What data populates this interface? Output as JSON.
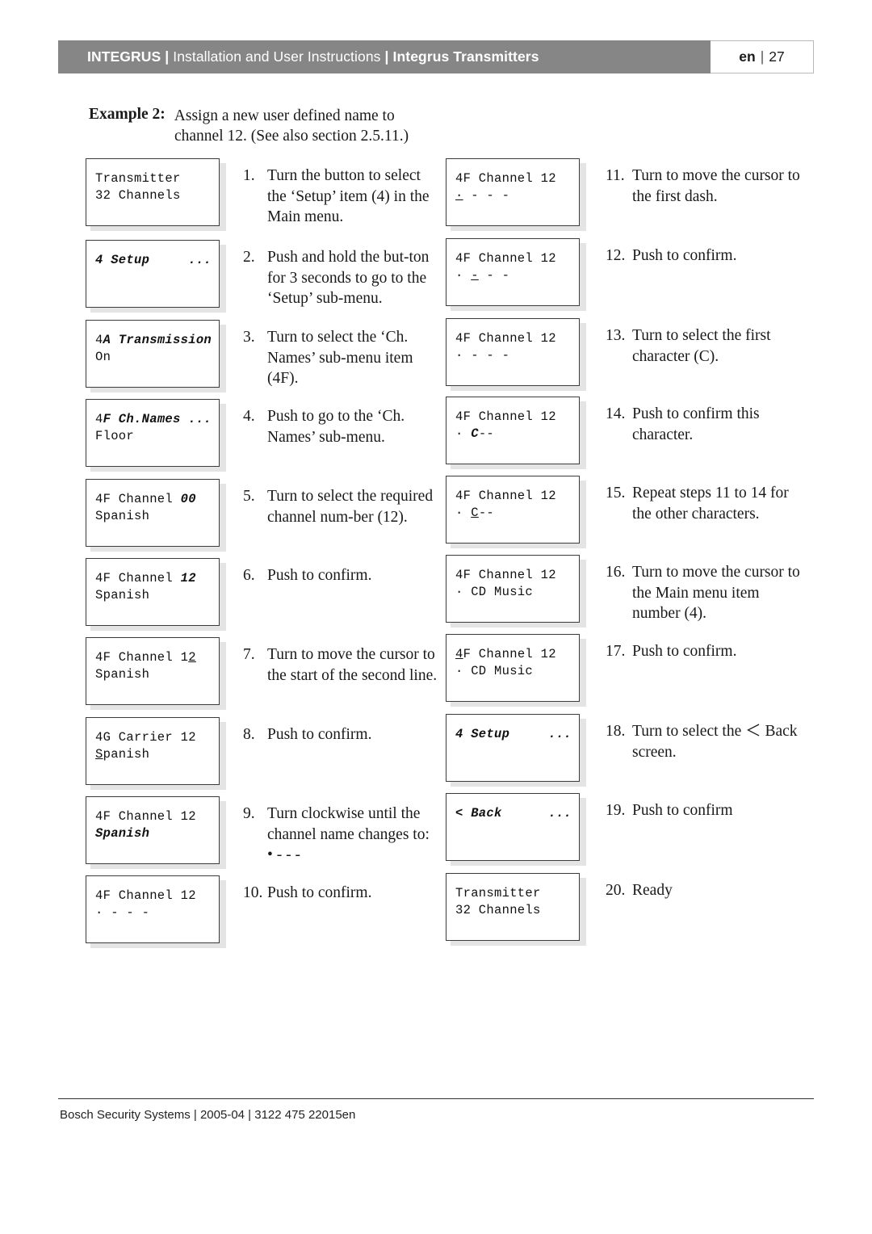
{
  "header": {
    "brand": "INTEGRUS",
    "sep": "|",
    "subtitle": "Installation and User Instructions",
    "section": "Integrus Transmitters",
    "language": "en",
    "page_number": "27"
  },
  "example": {
    "label": "Example 2:",
    "line1": "Assign a new user defined name to",
    "line2": "channel 12. (See also section 2.5.11.)"
  },
  "steps": [
    {
      "number": "1.",
      "text": "Turn the button to select the ‘Setup’ item (4) in the Main menu.",
      "lcd_line1": "Transmitter",
      "lcd_line2": "32 Channels"
    },
    {
      "number": "2.",
      "text": "Push and hold the but-ton for 3 seconds to go to the ‘Setup’ sub-menu.",
      "lcd_line1": "4 Setup     ...",
      "lcd_line2": ""
    },
    {
      "number": "3.",
      "text": "Turn to select the ‘Ch. Names’ sub-menu item (4F).",
      "lcd_line1": "4A Transmission",
      "lcd_line2": "On"
    },
    {
      "number": "4.",
      "text": "Push to go to the ‘Ch. Names’ sub-menu.",
      "lcd_line1": "4F Ch.Names ...",
      "lcd_line2": "Floor"
    },
    {
      "number": "5.",
      "text": "Turn to select the required channel num-ber (12).",
      "lcd_line1": "4F Channel 00",
      "lcd_line2": "Spanish"
    },
    {
      "number": "6.",
      "text": "Push to confirm.",
      "lcd_line1": "4F Channel 12",
      "lcd_line2": "Spanish"
    },
    {
      "number": "7.",
      "text": "Turn to move the cursor to the start of the second line.",
      "lcd_line1": "4F Channel 12",
      "lcd_line2": "Spanish"
    },
    {
      "number": "8.",
      "text": "Push to confirm.",
      "lcd_line1": "4G Carrier 12",
      "lcd_line2": "Spanish"
    },
    {
      "number": "9.",
      "text": "Turn clockwise until the channel name changes to: • - - -",
      "lcd_line1": "4F Channel 12",
      "lcd_line2": "Spanish"
    },
    {
      "number": "10.",
      "text": "Push to confirm.",
      "lcd_line1": "4F Channel 12",
      "lcd_line2": "· - - -"
    },
    {
      "number": "11.",
      "text": "Turn to move the cursor to the first dash.",
      "lcd_line1": "4F Channel 12",
      "lcd_line2": "· - - -"
    },
    {
      "number": "12.",
      "text": "Push to confirm.",
      "lcd_line1": "4F Channel 12",
      "lcd_line2": "· - - -"
    },
    {
      "number": "13.",
      "text": "Turn to select the first character (C).",
      "lcd_line1": "4F Channel 12",
      "lcd_line2": "· - - -"
    },
    {
      "number": "14.",
      "text": "Push to confirm this character.",
      "lcd_line1": "4F Channel 12",
      "lcd_line2": "· C--"
    },
    {
      "number": "15.",
      "text": "Repeat steps 11 to 14 for the other characters.",
      "lcd_line1": "4F Channel 12",
      "lcd_line2": "· C--"
    },
    {
      "number": "16.",
      "text": "Turn to move the cursor to the Main menu item number (4).",
      "lcd_line1": "4F Channel 12",
      "lcd_line2": "· CD Music"
    },
    {
      "number": "17.",
      "text": "Push to confirm.",
      "lcd_line1": "4F Channel 12",
      "lcd_line2": "· CD Music"
    },
    {
      "number": "18.",
      "text": "Turn to select the ＜ Back screen.",
      "lcd_line1": "4 Setup     ...",
      "lcd_line2": ""
    },
    {
      "number": "19.",
      "text": "Push to confirm",
      "lcd_line1": "< Back      ...",
      "lcd_line2": ""
    },
    {
      "number": "20.",
      "text": "Ready",
      "lcd_line1": "Transmitter",
      "lcd_line2": "32 Channels"
    }
  ],
  "footer": {
    "text": "Bosch Security Systems | 2005-04 | 3122 475 22015en"
  },
  "colors": {
    "header_bar": "#868686",
    "lcd_border": "#3b3b3b",
    "lcd_shadow": "#e4e4e4"
  }
}
